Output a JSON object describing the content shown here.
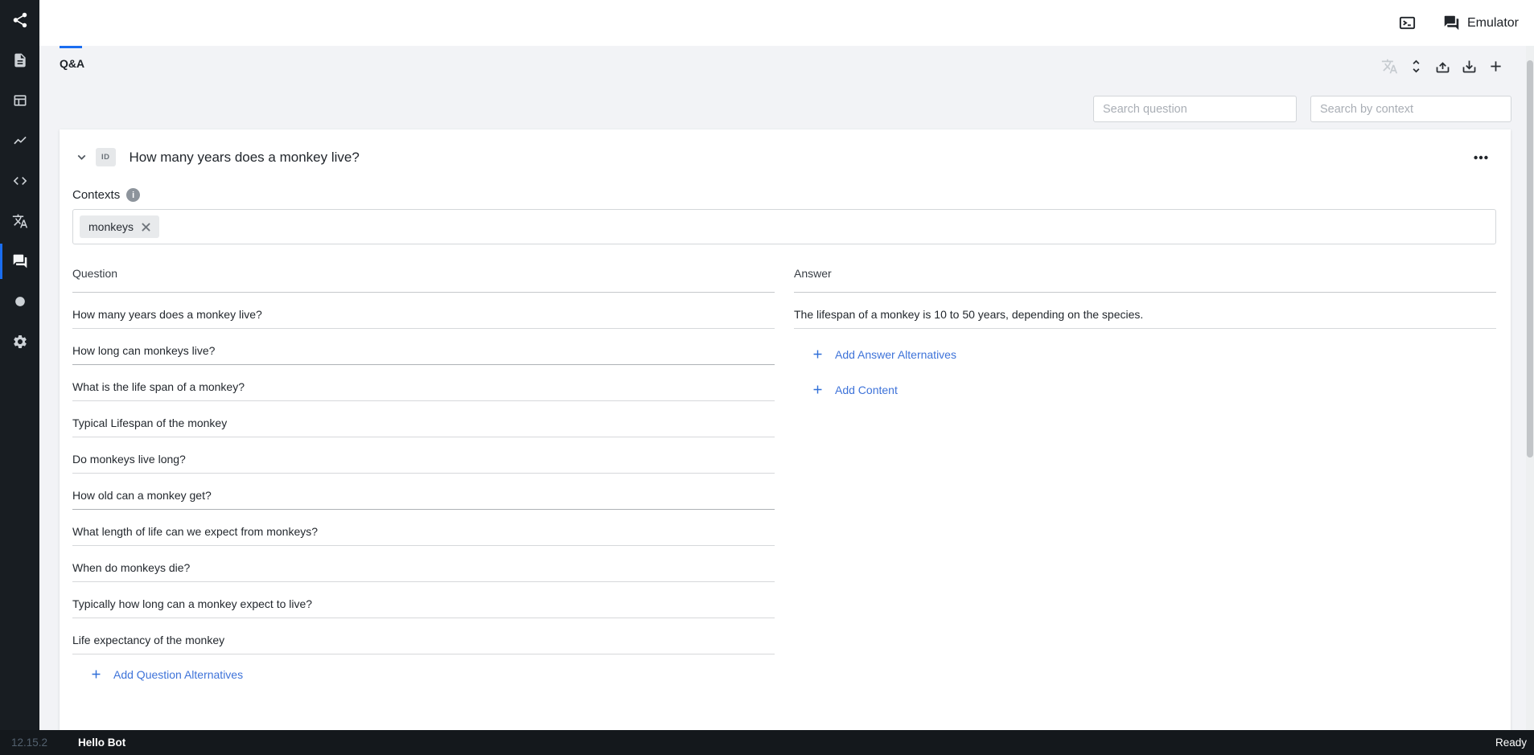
{
  "topbar": {
    "emulator_label": "Emulator"
  },
  "tabs": {
    "qna_label": "Q&A"
  },
  "toolbar": {
    "icons": [
      "translate-disabled",
      "expand-collapse",
      "upload",
      "download",
      "add"
    ]
  },
  "search": {
    "question_placeholder": "Search question",
    "context_placeholder": "Search by context"
  },
  "qna": {
    "id_badge": "ID",
    "title": "How many years does a monkey live?",
    "contexts_label": "Contexts",
    "context_tags": [
      "monkeys"
    ],
    "question_header": "Question",
    "answer_header": "Answer",
    "questions": [
      "How many years does a monkey live?",
      "How long can monkeys live?",
      "What is the life span of a monkey?",
      "Typical Lifespan of the monkey",
      "Do monkeys live long?",
      "How old can a monkey get?",
      "What length of life can we expect from monkeys?",
      "When do monkeys die?",
      "Typically how long can a monkey expect to live?",
      "Life expectancy of the monkey"
    ],
    "answer": "The lifespan of a monkey is 10 to 50 years, depending on the species.",
    "add_question_alternatives": "Add Question Alternatives",
    "add_answer_alternatives": "Add Answer Alternatives",
    "add_content": "Add Content"
  },
  "sidebar": {
    "icons": [
      "share-icon",
      "document-icon",
      "layout-icon",
      "chart-icon",
      "code-icon",
      "translate-icon",
      "chat-icon",
      "circle-icon",
      "settings-icon"
    ],
    "active": "chat-icon"
  },
  "statusbar": {
    "version": "12.15.2",
    "bot_name": "Hello Bot",
    "status": "Ready"
  },
  "colors": {
    "accent": "#1a6df0",
    "link": "#3e73d9",
    "sidebar_bg": "#181d22",
    "statusbar_bg": "#14181c"
  }
}
